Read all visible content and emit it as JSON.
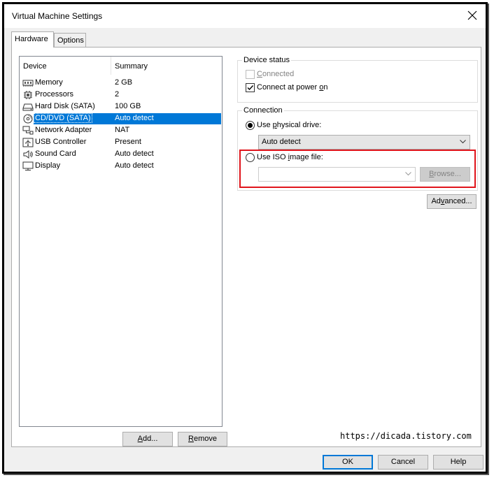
{
  "window": {
    "title": "Virtual Machine Settings",
    "close_glyph": "close-icon"
  },
  "tabs": [
    {
      "label": "Hardware"
    },
    {
      "label": "Options"
    }
  ],
  "device_list": {
    "headers": {
      "device": "Device",
      "summary": "Summary"
    },
    "rows": [
      {
        "icon": "memory-icon",
        "name": "Memory",
        "summary": "2 GB"
      },
      {
        "icon": "processor-icon",
        "name": "Processors",
        "summary": "2"
      },
      {
        "icon": "hard-disk-icon",
        "name": "Hard Disk (SATA)",
        "summary": "100 GB"
      },
      {
        "icon": "cd-dvd-icon",
        "name": "CD/DVD (SATA)",
        "summary": "Auto detect",
        "selected": true
      },
      {
        "icon": "network-adapter-icon",
        "name": "Network Adapter",
        "summary": "NAT"
      },
      {
        "icon": "usb-icon",
        "name": "USB Controller",
        "summary": "Present"
      },
      {
        "icon": "sound-card-icon",
        "name": "Sound Card",
        "summary": "Auto detect"
      },
      {
        "icon": "display-icon",
        "name": "Display",
        "summary": "Auto detect"
      }
    ],
    "add_pre": "",
    "add_key": "A",
    "add_post": "dd...",
    "remove_pre": "",
    "remove_key": "R",
    "remove_post": "emove"
  },
  "device_status": {
    "label": "Device status",
    "connected": {
      "pre": "",
      "key": "C",
      "post": "onnected",
      "checked": false,
      "enabled": false
    },
    "connect_power": {
      "pre": "Connect at power ",
      "key": "o",
      "post": "n",
      "checked": true,
      "enabled": true
    }
  },
  "connection": {
    "label": "Connection",
    "physical": {
      "pre": "Use ",
      "key": "p",
      "post": "hysical drive:",
      "selected": true
    },
    "physical_value": "Auto detect",
    "iso": {
      "pre": "Use ISO ",
      "key": "i",
      "post": "mage file:",
      "selected": false
    },
    "iso_value": "",
    "browse_pre": "",
    "browse_key": "B",
    "browse_post": "rowse..."
  },
  "advanced": {
    "pre": "Ad",
    "key": "v",
    "post": "anced..."
  },
  "footer": {
    "ok": "OK",
    "cancel": "Cancel",
    "help": "Help"
  },
  "watermark": "https://dicada.tistory.com",
  "colors": {
    "selection": "#0078d7",
    "highlight_box": "#e0141b"
  }
}
